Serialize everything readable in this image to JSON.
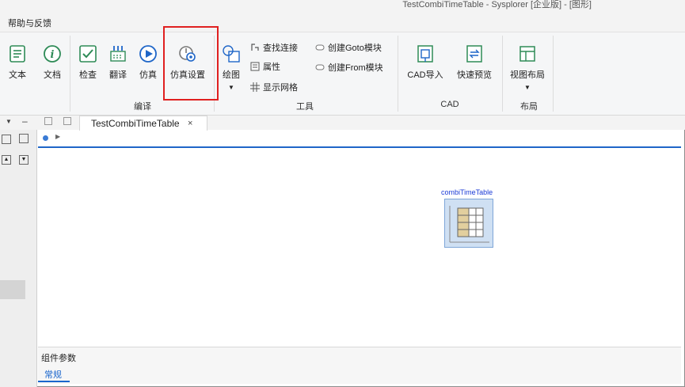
{
  "window": {
    "title": "TestCombiTimeTable - Sysplorer [企业版] - [图形]"
  },
  "menu": {
    "help": "帮助与反馈"
  },
  "ribbon": {
    "buttons": {
      "text": "文本",
      "doc": "文档",
      "check": "检查",
      "translate": "翻译",
      "simulate": "仿真",
      "sim_settings": "仿真设置",
      "draw": "绘图",
      "cad_import": "CAD导入",
      "quick_preview": "快速预览",
      "view_layout": "视图布局"
    },
    "small": {
      "find_conn": "查找连接",
      "properties": "属性",
      "show_grid": "显示网格",
      "create_goto": "创建Goto模块",
      "create_from": "创建From模块"
    },
    "groups": {
      "compile": "编译",
      "tools": "工具",
      "cad": "CAD",
      "layout": "布局"
    }
  },
  "tabs": [
    {
      "label": "TestCombiTimeTable",
      "close": "×"
    }
  ],
  "canvas": {
    "component_label": "combiTimeTable"
  },
  "bottom_panel": {
    "header": "组件参数",
    "subtab": "常规"
  },
  "colors": {
    "accent": "#1f66c8",
    "highlight": "#e02020",
    "component_fill": "#cfe0f3"
  }
}
